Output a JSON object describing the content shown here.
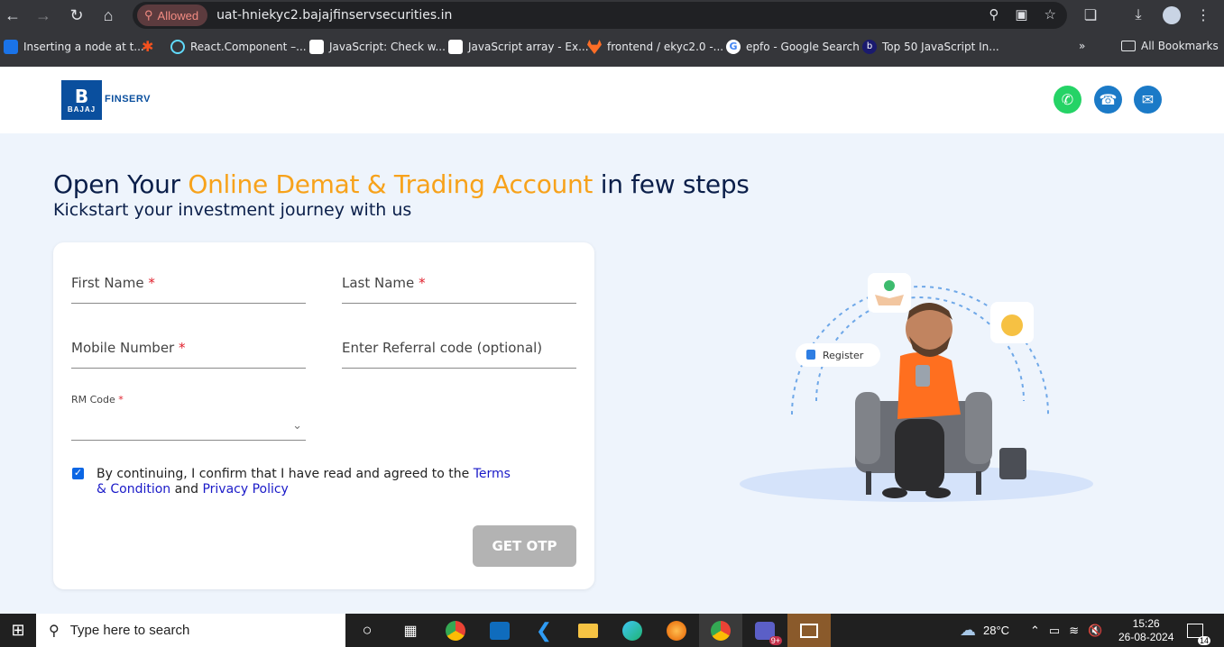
{
  "browser": {
    "permission_label": "Allowed",
    "url": "uat-hniekyc2.bajajfinservsecurities.in",
    "bookmarks": [
      {
        "label": "Inserting a node at t...",
        "color": "#1a73e8"
      },
      {
        "label": "",
        "color": "#f4511e"
      },
      {
        "label": "React.Component –...",
        "color": "#61dafb"
      },
      {
        "label": "JavaScript: Check w...",
        "color": "#ffffff"
      },
      {
        "label": "JavaScript array - Ex...",
        "color": "#ffffff"
      },
      {
        "label": "frontend / ekyc2.0 -...",
        "color": "#fc6d26"
      },
      {
        "label": "epfo - Google Search",
        "color": "#ffffff"
      },
      {
        "label": "Top 50 JavaScript In...",
        "color": "#1a1a6e"
      }
    ],
    "all_bookmarks_label": "All Bookmarks"
  },
  "brand": {
    "logo_letter": "B",
    "logo_small": "BAJAJ",
    "logo_text": "FINSERV",
    "colors": {
      "primary": "#0a4f9e",
      "accent": "#f7a21b",
      "whatsapp": "#25d366",
      "phone": "#1b7ac7",
      "mail": "#1b7ac7"
    }
  },
  "contact_icons": [
    "whatsapp-icon",
    "phone-icon",
    "mail-icon"
  ],
  "hero": {
    "title_pre": "Open Your ",
    "title_accent": "Online Demat & Trading Account",
    "title_post": " in few steps",
    "subtitle": "Kickstart your investment journey with us"
  },
  "form": {
    "first_name_label": "First Name",
    "last_name_label": "Last Name",
    "mobile_label": "Mobile Number",
    "referral_placeholder": "Enter Referral code (optional)",
    "required_mark": "*",
    "rm_code_label": "RM Code",
    "consent_text": "By continuing, I confirm that I have read and agreed to the ",
    "terms_link": "Terms & Condition",
    "consent_and": " and ",
    "privacy_link": "Privacy Policy",
    "consent_checked": true,
    "submit_label": "GET OTP"
  },
  "illustration": {
    "register_label": "Register"
  },
  "taskbar": {
    "search_placeholder": "Type here to search",
    "weather": "28°C",
    "time": "15:26",
    "date": "26-08-2024",
    "notifications": "14",
    "teams_badge": "9+"
  }
}
